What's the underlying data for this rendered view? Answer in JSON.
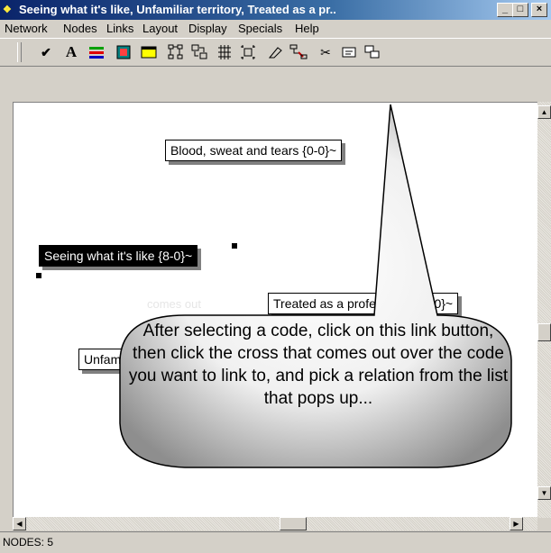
{
  "window": {
    "title": "Seeing what it's like, Unfamiliar territory, Treated as a pr..",
    "app_icon": "network-app-icon",
    "controls": [
      "_",
      "□",
      "×"
    ]
  },
  "menu": [
    "Network",
    "Nodes",
    "Links",
    "Layout",
    "Display",
    "Specials",
    "Help"
  ],
  "toolbar": {
    "tools": [
      {
        "name": "check-icon",
        "glyph": "✔"
      },
      {
        "name": "font-icon",
        "glyph": "A"
      },
      {
        "name": "line-color-icon",
        "glyph": ""
      },
      {
        "name": "fill-color-icon",
        "glyph": ""
      },
      {
        "name": "yellow-box-icon",
        "glyph": ""
      },
      {
        "name": "layout-tree-icon",
        "glyph": ""
      },
      {
        "name": "layout-arrange-icon",
        "glyph": ""
      },
      {
        "name": "layout-grid-icon",
        "glyph": ""
      },
      {
        "name": "layout-cluster-icon",
        "glyph": ""
      },
      {
        "name": "eraser-icon",
        "glyph": "⌫"
      },
      {
        "name": "link-icon",
        "glyph": ""
      },
      {
        "name": "cut-icon",
        "glyph": "✂"
      },
      {
        "name": "card-icon",
        "glyph": "▭"
      },
      {
        "name": "copy-nodes-icon",
        "glyph": ""
      }
    ]
  },
  "nodes": [
    {
      "label": "Blood, sweat and tears {0-0}~",
      "selected": false
    },
    {
      "label": "Seeing what it's like {8-0}~",
      "selected": true
    },
    {
      "label": "Treated as a professional {6-0}~",
      "selected": false
    },
    {
      "label": "Unfamiliar territory {3-0}~",
      "selected": false
    }
  ],
  "faint_text": "comes out",
  "callout": {
    "text": "After selecting a code, click on this link button, then click the cross that comes out over the code you want to link to, and pick a relation from the list that pops up..."
  },
  "status": {
    "text": "NODES: 5"
  }
}
